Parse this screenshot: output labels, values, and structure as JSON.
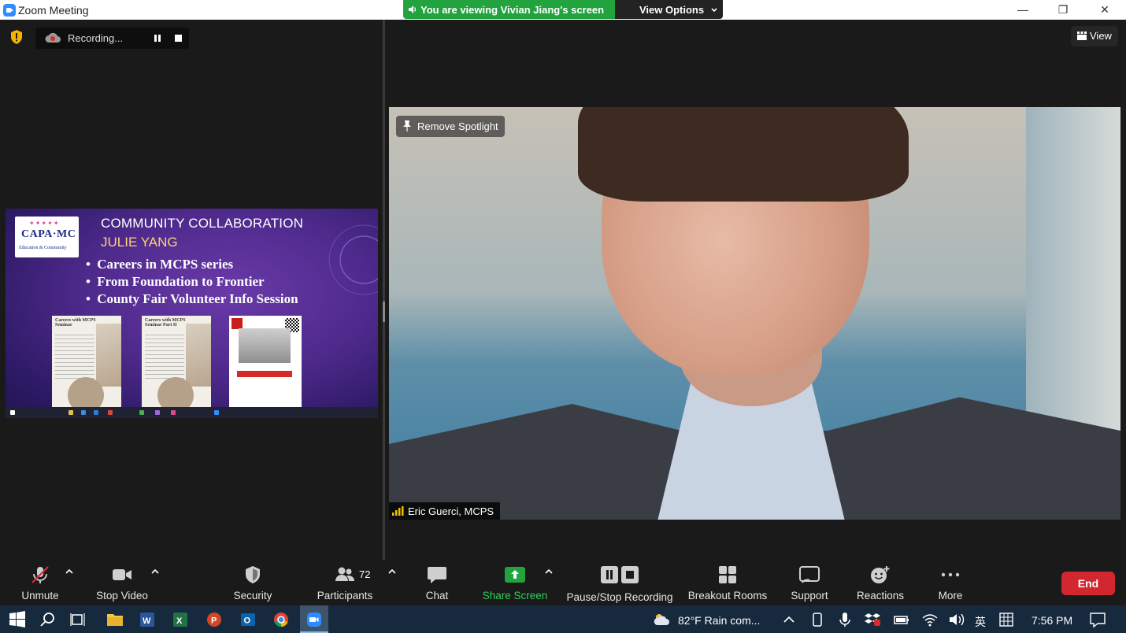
{
  "window": {
    "title": "Zoom Meeting",
    "viewing_banner": "You are viewing Vivian Jiang's screen",
    "view_options": "View Options",
    "minimize": "—",
    "restore": "❐",
    "close": "✕"
  },
  "recording": {
    "label": "Recording..."
  },
  "shared_slide": {
    "logo_text": "CAPA·MC",
    "logo_sub": "Education & Community",
    "title": "COMMUNITY COLLABORATION",
    "subtitle": "JULIE YANG",
    "bullets": [
      "Careers in MCPS series",
      "From Foundation to Frontier",
      "County Fair Volunteer Info Session"
    ],
    "flyer1_title": "Careers with MCPS Seminar",
    "flyer2_title": "Careers with MCPS Seminar Part II"
  },
  "spotlight": {
    "view_label": "View",
    "remove_spotlight": "Remove Spotlight",
    "participant_name": "Eric Guerci, MCPS"
  },
  "toolbar": {
    "unmute": "Unmute",
    "stop_video": "Stop Video",
    "security": "Security",
    "participants": "Participants",
    "participants_count": "72",
    "chat": "Chat",
    "share_screen": "Share Screen",
    "pause_stop_recording": "Pause/Stop Recording",
    "breakout_rooms": "Breakout Rooms",
    "support": "Support",
    "reactions": "Reactions",
    "more": "More",
    "end": "End"
  },
  "taskbar": {
    "weather": "82°F  Rain com...",
    "ime": "英",
    "time": "7:56 PM"
  },
  "colors": {
    "zoom_blue": "#2D8CFF",
    "share_green": "#23A33E",
    "end_red": "#D2272E",
    "mute_red": "#E02828"
  }
}
